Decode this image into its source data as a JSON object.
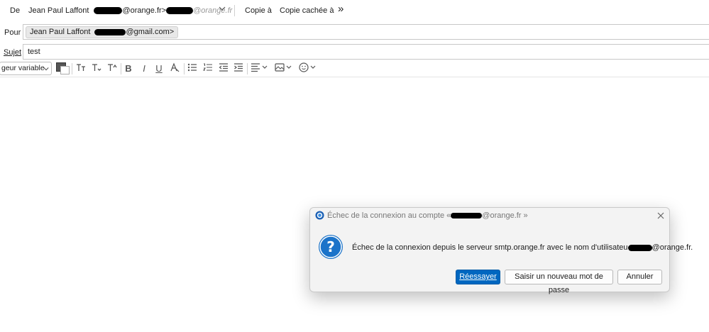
{
  "header": {
    "from_label": "De",
    "from_name": "Jean Paul Laffont",
    "from_domain": "@orange.fr>",
    "from_alias_domain": "@orange.fr",
    "copy_label": "Copie à",
    "bcc_label": "Copie cachée à",
    "more_label": "»"
  },
  "to": {
    "label": "Pour",
    "recipient_name": "Jean Paul Laffont",
    "recipient_domain": "@gmail.com>"
  },
  "subject": {
    "label": "Sujet",
    "value": "test"
  },
  "toolbar": {
    "font_select": "geur variable",
    "icons": [
      "text-color-icon",
      "font-smaller-icon",
      "font-smaller2-icon",
      "font-larger-icon",
      "bold-icon",
      "italic-icon",
      "underline-icon",
      "clear-format-icon",
      "bullet-list-icon",
      "numbered-list-icon",
      "outdent-icon",
      "indent-icon",
      "align-icon",
      "insert-image-icon",
      "emoji-icon"
    ]
  },
  "dialog": {
    "title_prefix": "Échec de la connexion au compte «",
    "title_suffix": "@orange.fr »",
    "message_prefix": "Échec de la connexion depuis le serveur smtp.orange.fr avec le nom d'utilisateu",
    "message_suffix": "@orange.fr.",
    "retry_label": "Réessayer",
    "new_password_label": "Saisir un nouveau mot de passe",
    "cancel_label": "Annuler",
    "accent_color": "#0067c0"
  }
}
